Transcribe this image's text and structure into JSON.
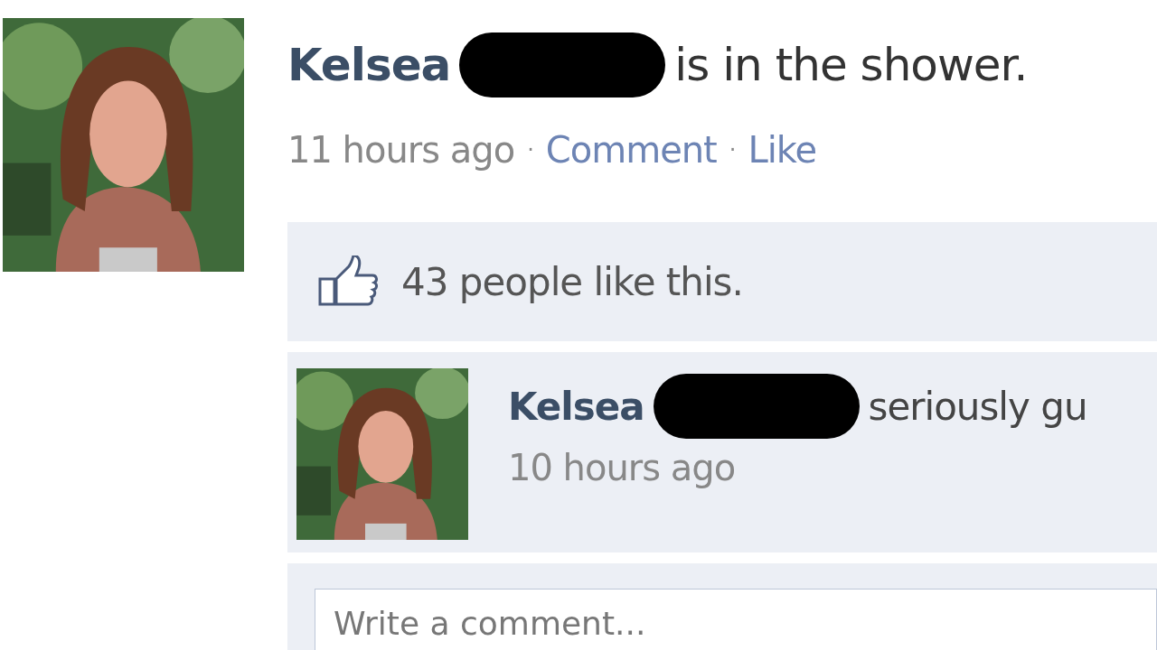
{
  "post": {
    "author": "Kelsea",
    "status": "is in the shower.",
    "meta": [
      {
        "kind": "time",
        "text": "11 hours ago"
      },
      {
        "kind": "separator",
        "text": "·"
      },
      {
        "kind": "link",
        "text": "Comment"
      },
      {
        "kind": "separator",
        "text": "·"
      },
      {
        "kind": "link",
        "text": "Like"
      }
    ],
    "likes": "43 people like this.",
    "comments": [
      {
        "author": "Kelsea",
        "text": "seriously gu",
        "time": "10 hours ago"
      }
    ],
    "comment_field": {
      "placeholder": "Write a comment..."
    }
  }
}
